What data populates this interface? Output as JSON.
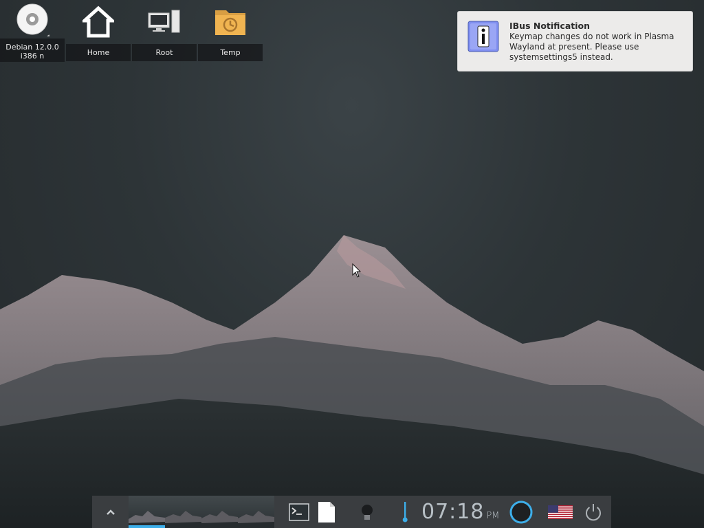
{
  "desktop": {
    "icons": [
      {
        "label": "Debian 12.0.0 i386 n",
        "icon": "optical-disc-icon"
      },
      {
        "label": "Home",
        "icon": "home-icon"
      },
      {
        "label": "Root",
        "icon": "computer-icon"
      },
      {
        "label": "Temp",
        "icon": "folder-clock-icon"
      }
    ]
  },
  "notification": {
    "title": "IBus Notification",
    "body": "Keymap changes do not work in Plasma Wayland at present. Please use systemsettings5 instead.",
    "icon": "info-icon"
  },
  "panel": {
    "clock_time": "07:18",
    "clock_ampm": "PM",
    "accent": "#3daee9",
    "items": [
      "show-desktop-arrow-icon",
      "pager",
      "terminal-icon",
      "document-icon",
      "bulb-icon",
      "thermometer-icon",
      "clock",
      "ring-icon",
      "us-flag-icon",
      "power-icon"
    ],
    "active_desktop": 1
  },
  "colors": {
    "panel_bg": "#3a3d40",
    "notification_bg": "#ecebea"
  }
}
